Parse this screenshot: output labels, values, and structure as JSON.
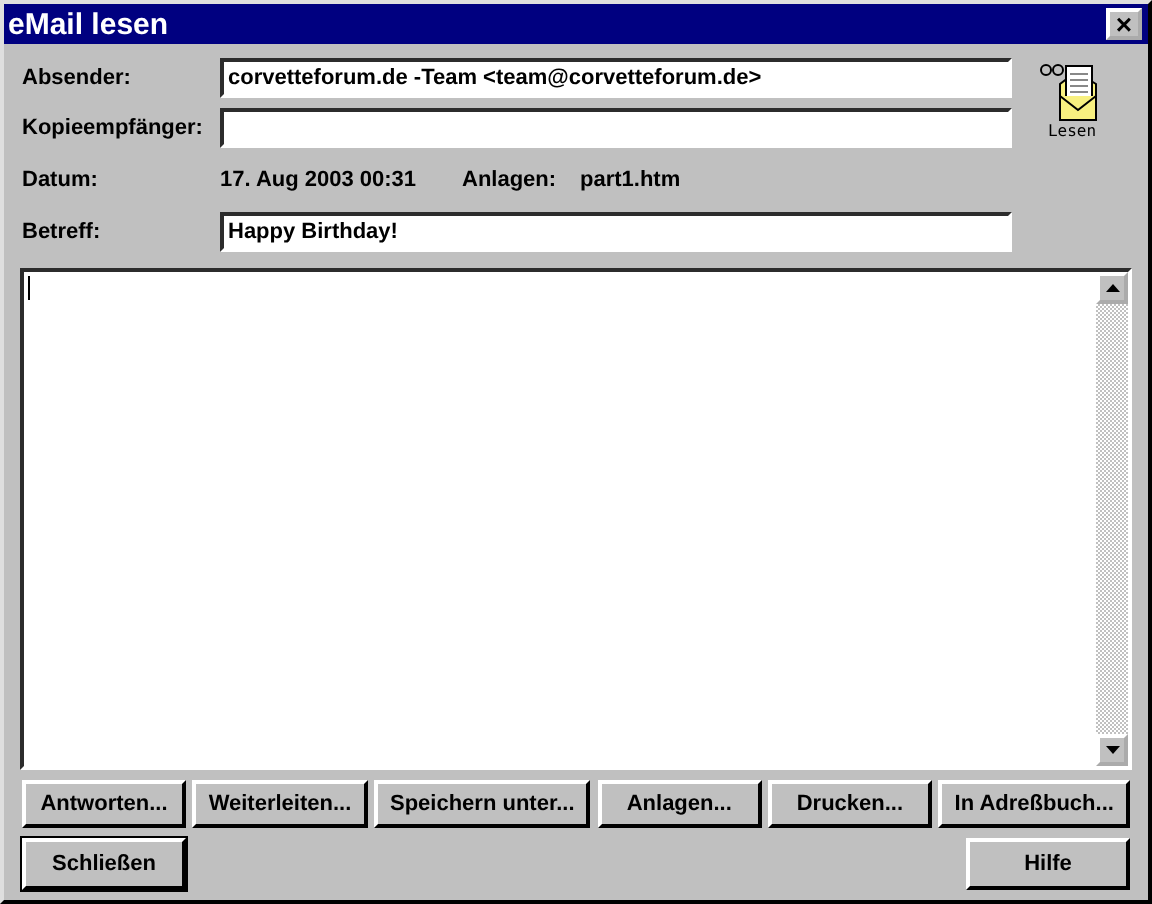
{
  "window": {
    "title": "eMail lesen",
    "close": "×"
  },
  "fields": [
    {
      "label": "Absender:",
      "value": "corvetteforum.de -Team <team@corvetteforum.de>"
    },
    {
      "label": "Kopieempfänger:"
    }
  ],
  "info": {
    "date_label": "Datum:",
    "date": "17. Aug 2003 00:31",
    "attach_label": "Anlagen:",
    "attach": "part1.htm"
  },
  "subject": {
    "label": "Betreff:",
    "value": "Happy Birthday!"
  },
  "icon_label": "Lesen",
  "buttons": [
    {
      "label": "Antworten..."
    },
    {
      "label": "Weiterleiten..."
    },
    {
      "label": "Speichern unter..."
    },
    {
      "label": "Anlagen..."
    },
    {
      "label": "Drucken..."
    },
    {
      "label": "In Adreßbuch..."
    }
  ],
  "bottom_buttons": [
    {
      "label": "Schließen",
      "default": true
    },
    {
      "label": "Hilfe",
      "default": false
    }
  ]
}
